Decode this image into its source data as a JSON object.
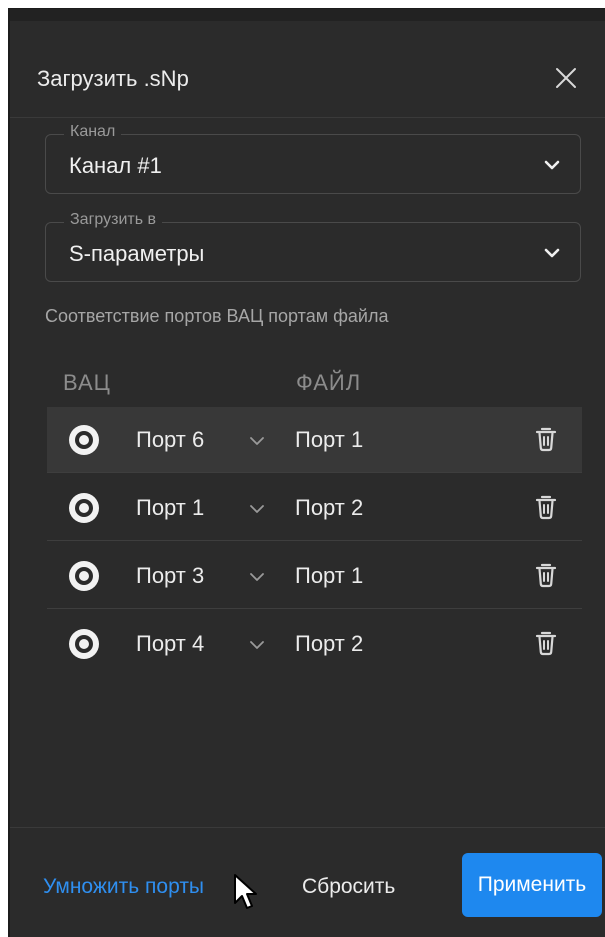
{
  "dialog": {
    "title": "Загрузить .sNp"
  },
  "channel_field": {
    "legend": "Канал",
    "value": "Канал #1"
  },
  "load_into_field": {
    "legend": "Загрузить в",
    "value": "S-параметры"
  },
  "hint": "Соответствие портов ВАЦ портам файла",
  "columns": {
    "vna": "ВАЦ",
    "file": "ФАЙЛ"
  },
  "rows": [
    {
      "vna_port": "Порт 6",
      "file_port": "Порт 1",
      "selected": true
    },
    {
      "vna_port": "Порт 1",
      "file_port": "Порт 2",
      "selected": false
    },
    {
      "vna_port": "Порт 3",
      "file_port": "Порт 1",
      "selected": false
    },
    {
      "vna_port": "Порт 4",
      "file_port": "Порт 2",
      "selected": false
    }
  ],
  "footer": {
    "multiply_label": "Умножить порты",
    "reset_label": "Сбросить",
    "apply_label": "Применить"
  },
  "colors": {
    "background": "#2b2b2b",
    "accent": "#1e88ef",
    "link": "#2f8ff0",
    "text": "#ececec"
  },
  "icons": [
    "close-icon",
    "chevron-down-icon",
    "radio-icon",
    "trash-icon",
    "mouse-cursor-icon"
  ]
}
